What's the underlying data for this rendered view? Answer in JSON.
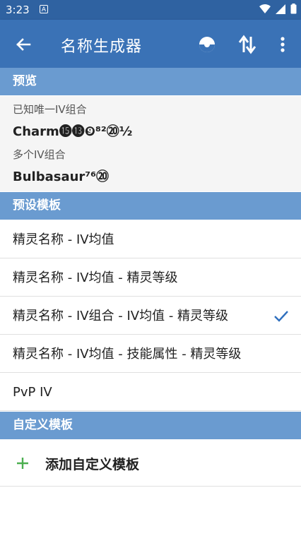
{
  "status_bar": {
    "time": "3:23",
    "notification_glyph": "A"
  },
  "toolbar": {
    "title": "名称生成器",
    "back_icon": "arrow-back-icon",
    "pokeball_icon": "pokeball-icon",
    "swap_icon": "swap-icon",
    "more_icon": "more-vert-icon"
  },
  "preview": {
    "header": "预览",
    "unique_label": "已知唯一IV组合",
    "unique_value": "Charm⓯⓭❾⁸²⑳½",
    "multi_label": "多个IV组合",
    "multi_value": "Bulbasaur⁷⁶⑳"
  },
  "presets": {
    "header": "预设模板",
    "items": [
      {
        "label": "精灵名称 - IV均值",
        "selected": false
      },
      {
        "label": "精灵名称 - IV均值 - 精灵等级",
        "selected": false
      },
      {
        "label": "精灵名称 - IV组合 - IV均值 - 精灵等级",
        "selected": true
      },
      {
        "label": "精灵名称 - IV均值 - 技能属性 - 精灵等级",
        "selected": false
      },
      {
        "label": "PvP IV",
        "selected": false
      }
    ]
  },
  "custom": {
    "header": "自定义模板",
    "add_label": "添加自定义模板"
  },
  "colors": {
    "status_bar": "#2f62a1",
    "toolbar": "#3a72b6",
    "section_header": "#6a9bd0",
    "check": "#2f6fbe",
    "plus": "#4caf50"
  }
}
